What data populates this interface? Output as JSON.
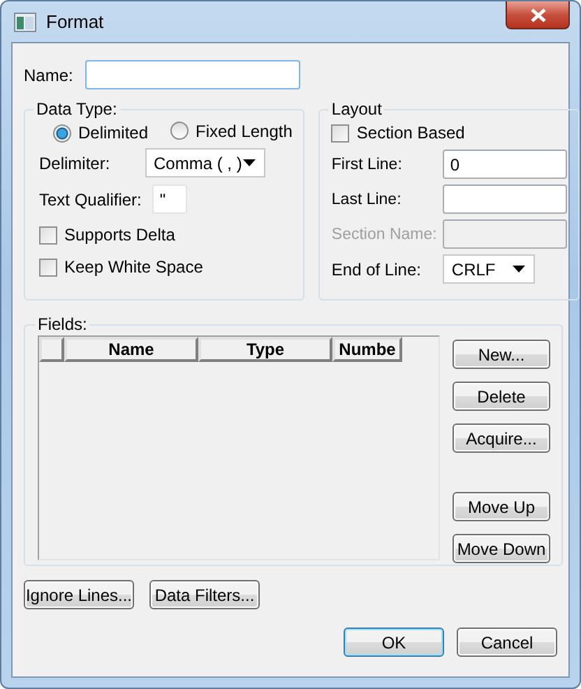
{
  "window": {
    "title": "Format"
  },
  "name": {
    "label": "Name:"
  },
  "data_type": {
    "title": "Data Type:",
    "options": [
      {
        "label": "Delimited",
        "selected": true
      },
      {
        "label": "Fixed Length",
        "selected": false
      }
    ],
    "delimiter": {
      "label": "Delimiter:",
      "value": "Comma ( , )"
    },
    "text_qualifier": {
      "label": "Text Qualifier:",
      "value": "\""
    },
    "checkboxes": [
      {
        "label": "Supports Delta",
        "checked": false
      },
      {
        "label": "Keep White Space",
        "checked": false
      }
    ]
  },
  "layout": {
    "title": "Layout",
    "section_based": {
      "label": "Section Based",
      "checked": false
    },
    "fields": [
      {
        "label": "First Line:",
        "value": "0",
        "disabled": false
      },
      {
        "label": "Last Line:",
        "disabled": false
      },
      {
        "label": "Section Name:",
        "disabled": true
      }
    ],
    "end_of_line": {
      "label": "End of Line:",
      "value": "CRLF"
    }
  },
  "fields": {
    "title": "Fields:",
    "columns": [
      "Name",
      "Type",
      "Numbe"
    ],
    "buttons": [
      "New...",
      "Delete",
      "Acquire...",
      "Move Up",
      "Move Down"
    ]
  },
  "bottom_buttons": [
    "Ignore Lines...",
    "Data Filters..."
  ],
  "dialog_buttons": [
    {
      "label": "OK",
      "default": true
    },
    {
      "label": "Cancel",
      "default": false
    }
  ]
}
